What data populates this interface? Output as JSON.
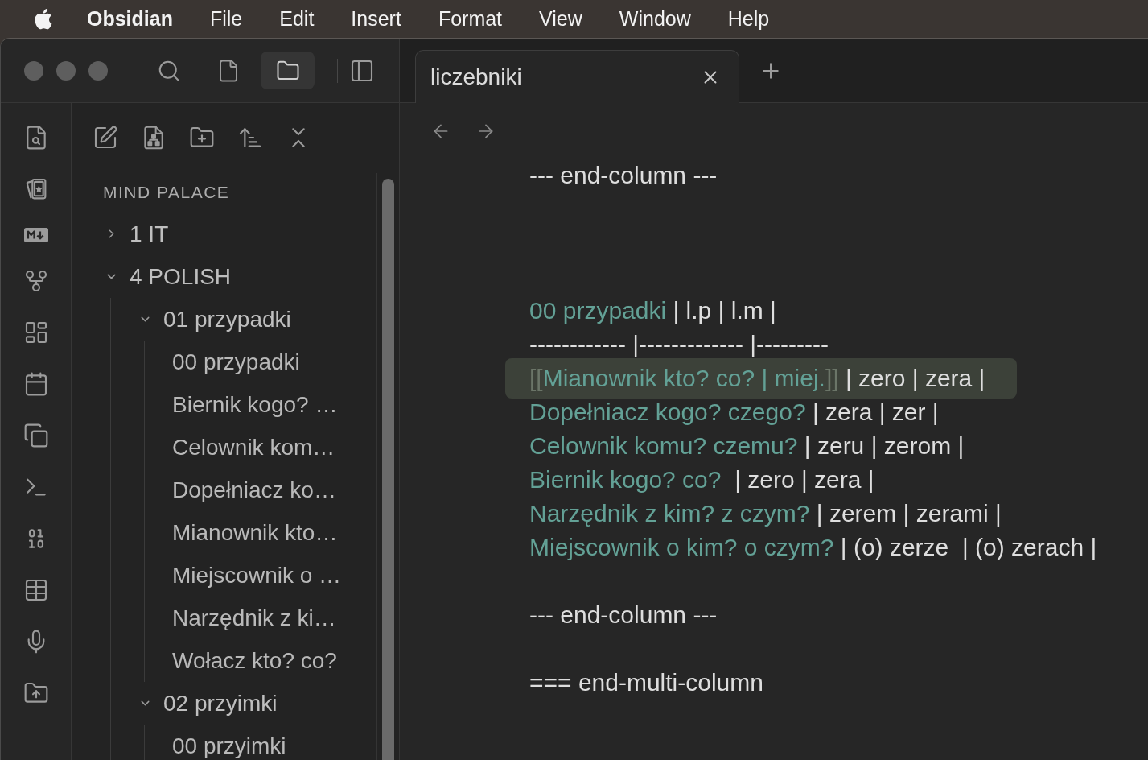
{
  "menu_bar": {
    "app_name": "Obsidian",
    "items": [
      "File",
      "Edit",
      "Insert",
      "Format",
      "View",
      "Window",
      "Help"
    ]
  },
  "sidebar_tabs": [
    {
      "selected": false
    },
    {
      "selected": false
    },
    {
      "selected": true
    }
  ],
  "file_explorer": {
    "vault_name": "MIND PALACE",
    "tree": [
      {
        "kind": "folder",
        "label": "1 IT",
        "expanded": false
      },
      {
        "kind": "folder",
        "label": "4 POLISH",
        "expanded": true,
        "children": [
          {
            "kind": "folder",
            "label": "01 przypadki",
            "expanded": true,
            "children": [
              {
                "kind": "file",
                "label": "00 przypadki"
              },
              {
                "kind": "file",
                "label": "Biernik kogo? …"
              },
              {
                "kind": "file",
                "label": "Celownik kom…"
              },
              {
                "kind": "file",
                "label": "Dopełniacz ko…"
              },
              {
                "kind": "file",
                "label": "Mianownik kto…"
              },
              {
                "kind": "file",
                "label": "Miejscownik o …"
              },
              {
                "kind": "file",
                "label": "Narzędnik z ki…"
              },
              {
                "kind": "file",
                "label": "Wołacz kto? co?"
              }
            ]
          },
          {
            "kind": "folder",
            "label": "02 przyimki",
            "expanded": true,
            "children": [
              {
                "kind": "file",
                "label": "00 przyimki"
              }
            ]
          }
        ]
      }
    ]
  },
  "tabs": [
    {
      "title": "liczebniki",
      "selected": true
    }
  ],
  "editor": {
    "lines": [
      {
        "kind": "text",
        "active": false,
        "segments": [
          {
            "kind": "plain",
            "text": "--- end-column ---"
          }
        ]
      },
      {
        "kind": "blank"
      },
      {
        "kind": "blank"
      },
      {
        "kind": "blank"
      },
      {
        "kind": "text",
        "active": false,
        "segments": [
          {
            "kind": "link",
            "text": "00 przypadki"
          },
          {
            "kind": "plain",
            "text": " | l.p | l.m |"
          }
        ]
      },
      {
        "kind": "text",
        "active": false,
        "segments": [
          {
            "kind": "plain",
            "text": "------------ |------------- |---------"
          }
        ]
      },
      {
        "kind": "text",
        "active": true,
        "segments": [
          {
            "kind": "bracket",
            "text": "[["
          },
          {
            "kind": "link",
            "text": "Mianownik kto? co? | miej."
          },
          {
            "kind": "bracket",
            "text": "]]"
          },
          {
            "kind": "plain",
            "text": " | zero | zera |"
          }
        ]
      },
      {
        "kind": "text",
        "active": false,
        "segments": [
          {
            "kind": "link",
            "text": "Dopełniacz kogo? czego?"
          },
          {
            "kind": "plain",
            "text": " | zera | zer |"
          }
        ]
      },
      {
        "kind": "text",
        "active": false,
        "segments": [
          {
            "kind": "link",
            "text": "Celownik komu? czemu?"
          },
          {
            "kind": "plain",
            "text": " | zeru | zerom |"
          }
        ]
      },
      {
        "kind": "text",
        "active": false,
        "segments": [
          {
            "kind": "link",
            "text": "Biernik kogo? co?"
          },
          {
            "kind": "plain",
            "text": "  | zero | zera |"
          }
        ]
      },
      {
        "kind": "text",
        "active": false,
        "segments": [
          {
            "kind": "link",
            "text": "Narzędnik z kim? z czym?"
          },
          {
            "kind": "plain",
            "text": " | zerem | zerami |"
          }
        ]
      },
      {
        "kind": "text",
        "active": false,
        "segments": [
          {
            "kind": "link",
            "text": "Miejscownik o kim? o czym?"
          },
          {
            "kind": "plain",
            "text": " | (o) zerze  | (o) zerach |"
          }
        ]
      },
      {
        "kind": "blank"
      },
      {
        "kind": "text",
        "active": false,
        "segments": [
          {
            "kind": "plain",
            "text": "--- end-column ---"
          }
        ]
      },
      {
        "kind": "blank"
      },
      {
        "kind": "text",
        "active": false,
        "segments": [
          {
            "kind": "plain",
            "text": "=== end-multi-column"
          }
        ]
      }
    ]
  }
}
